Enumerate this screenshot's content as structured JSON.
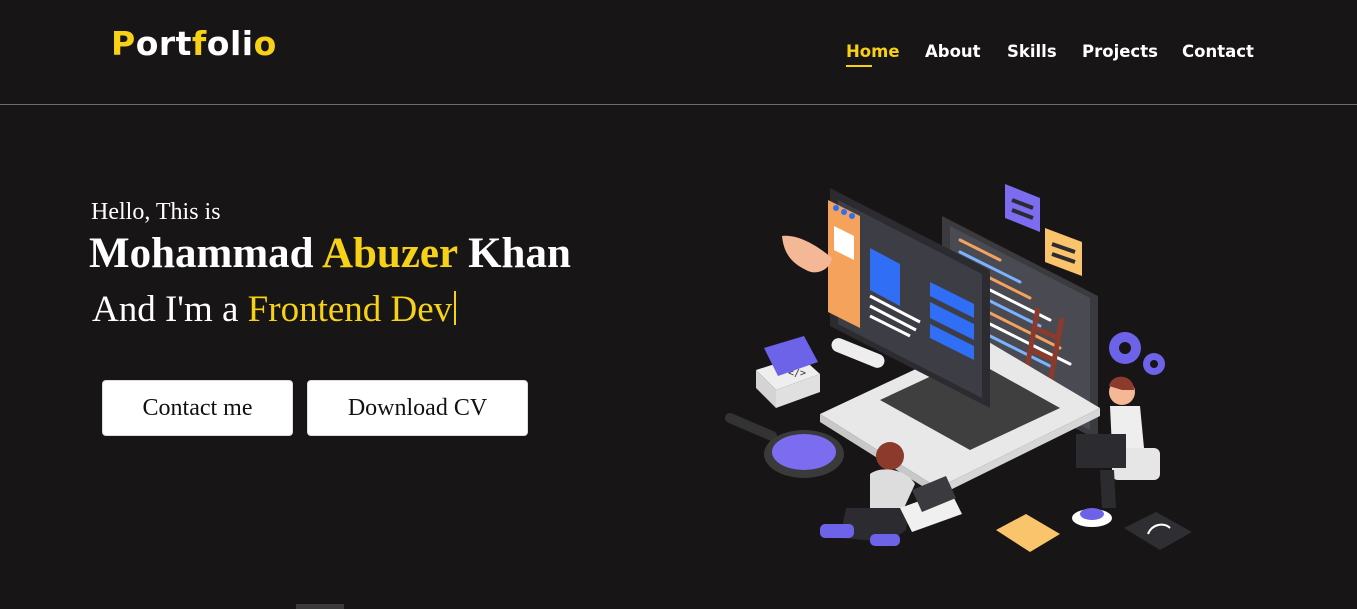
{
  "header": {
    "logo": {
      "part1": "P",
      "part2": "ort",
      "part3": "f",
      "part4": "oli",
      "part5": "o"
    },
    "nav": [
      {
        "label": "Home",
        "active": true
      },
      {
        "label": "About",
        "active": false
      },
      {
        "label": "Skills",
        "active": false
      },
      {
        "label": "Projects",
        "active": false
      },
      {
        "label": "Contact",
        "active": false
      }
    ]
  },
  "hero": {
    "greeting": "Hello, This is",
    "name_first": "Mohammad",
    "name_middle": "Abuzer",
    "name_last": "Khan",
    "role_prefix": "And I'm a",
    "role_typed": "Frontend Dev",
    "buttons": {
      "contact": "Contact me",
      "download": "Download CV"
    },
    "illustration": "developer-workspace-illustration",
    "code_tag": "</>"
  },
  "colors": {
    "background": "#171515",
    "accent": "#f7d117",
    "text": "#ffffff"
  }
}
